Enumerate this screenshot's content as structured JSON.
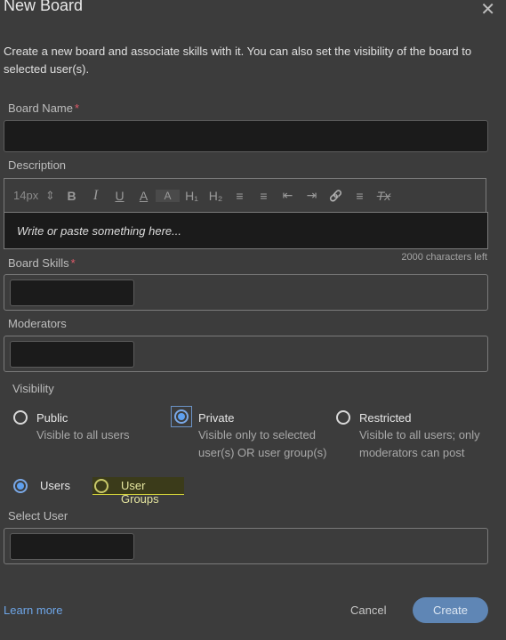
{
  "dialog": {
    "title": "New Board",
    "close_glyph": "✕",
    "intro": "Create a new board and associate skills with it. You can also set the visibility of the board to selected user(s)."
  },
  "board_name": {
    "label": "Board Name",
    "required_mark": "*",
    "value": ""
  },
  "description": {
    "label": "Description",
    "font_size": "14px",
    "font_size_arrows": "⇕",
    "toolbar": {
      "bold": "B",
      "italic": "I",
      "underline": "U",
      "font_color": "A",
      "bg_color": "A",
      "h1": "H₁",
      "h2": "H₂",
      "ordered_list": "≡",
      "bullet_list": "≡",
      "outdent": "⇤",
      "indent": "⇥",
      "link": "🔗",
      "align": "≡",
      "clear_format": "Tx"
    },
    "placeholder": "Write or paste something here...",
    "chars_left": "2000 characters left"
  },
  "board_skills": {
    "label": "Board Skills",
    "required_mark": "*"
  },
  "moderators": {
    "label": "Moderators"
  },
  "visibility": {
    "label": "Visibility",
    "selected": "Private",
    "options": [
      {
        "title": "Public",
        "desc1": "Visible to all users",
        "desc2": ""
      },
      {
        "title": "Private",
        "desc1": "Visible only to selected",
        "desc2": "user(s) OR user group(s)"
      },
      {
        "title": "Restricted",
        "desc1": "Visible to all users; only",
        "desc2": "moderators can post"
      }
    ]
  },
  "target": {
    "selected": "Users",
    "options": [
      "Users",
      "User Groups"
    ]
  },
  "select_user": {
    "label": "Select User"
  },
  "footer": {
    "learn_more": "Learn more",
    "cancel": "Cancel",
    "create": "Create"
  },
  "colors": {
    "background": "#3c3c3c",
    "input_bg": "#1b1b1b",
    "accent": "#5ea0f0",
    "create_button": "#5f86b5",
    "required": "#e05a6a",
    "highlight_marker": "#d4d43a"
  }
}
